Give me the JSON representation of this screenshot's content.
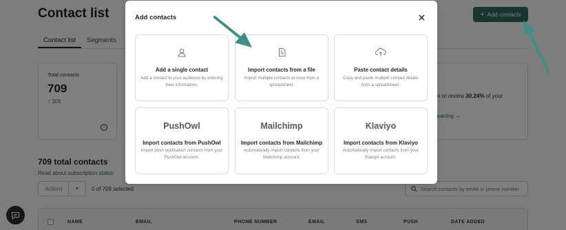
{
  "page": {
    "title": "Contact list",
    "add_button_label": "Add contacts",
    "tabs": [
      {
        "label": "Contact list"
      },
      {
        "label": "Segments"
      }
    ],
    "stats": {
      "label": "Total contacts",
      "value": "709",
      "delta": "305"
    },
    "right_card": {
      "text_prefix": "n or review",
      "text_bold": "30.24%",
      "text_suffix": "of your",
      "link": "cleaning →"
    },
    "total_heading": "709 total contacts",
    "subscription_link": "Read about subscription status",
    "actions_label": "Actions",
    "selected_count": "0 of 709 selected",
    "search_placeholder": "Search contacts by email or phone number",
    "table_headers": [
      "NAME",
      "EMAIL",
      "PHONE NUMBER",
      "EMAIL",
      "SMS",
      "PUSH",
      "DATE ADDED"
    ]
  },
  "modal": {
    "title": "Add contacts",
    "options": [
      {
        "title": "Add a single contact",
        "desc": "Add a contact to your audience by entering their information.",
        "icon": "person-icon"
      },
      {
        "title": "Import contacts from a file",
        "desc": "Import multiple contacts at once from a spreadsheet.",
        "icon": "file-icon"
      },
      {
        "title": "Paste contact details",
        "desc": "Copy and paste multiple contact details from a spreadsheet.",
        "icon": "upload-cloud-icon"
      },
      {
        "logo": "PushOwl",
        "title": "Import contacts from PushOwl",
        "desc": "Import push notification contacts from your PushOwl account."
      },
      {
        "logo": "Mailchimp",
        "title": "Import contacts from Mailchimp",
        "desc": "Automatically import contacts from your Mailchimp account."
      },
      {
        "logo": "Klaviyo",
        "title": "Import contacts from Klaviyo",
        "desc": "Automatically import contacts from your Klaviyo account."
      }
    ]
  },
  "colors": {
    "brand": "#2f6a63",
    "arrow": "#3f8f86",
    "overlay": "rgba(0,0,0,0.5)"
  }
}
